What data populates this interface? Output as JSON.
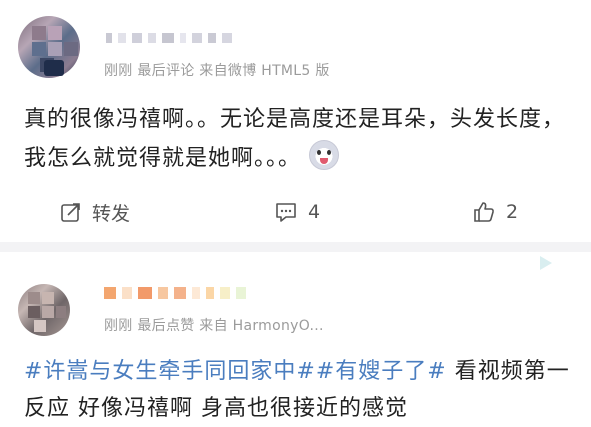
{
  "post1": {
    "meta": "刚刚 最后评论 来自微博 HTML5 版",
    "text": "真的很像冯禧啊。。无论是高度还是耳朵，头发长度，我怎么就觉得就是她啊。。。",
    "actions": {
      "repost_label": "转发",
      "comment_count": "4",
      "like_count": "2"
    }
  },
  "post2": {
    "meta": "刚刚 最后点赞 来自 HarmonyO...",
    "tag1": "#许嵩与女生牵手同回家中#",
    "tag2": "#有嫂子了#",
    "text": "看视频第一反应 好像冯禧啊 身高也很接近的感觉"
  },
  "icons": [
    "repost-icon",
    "comment-icon",
    "like-icon",
    "emoji-icon",
    "verified-icon"
  ],
  "colors": {
    "link": "#4a7dbf",
    "meta": "#9b9b9b",
    "text": "#222222"
  }
}
